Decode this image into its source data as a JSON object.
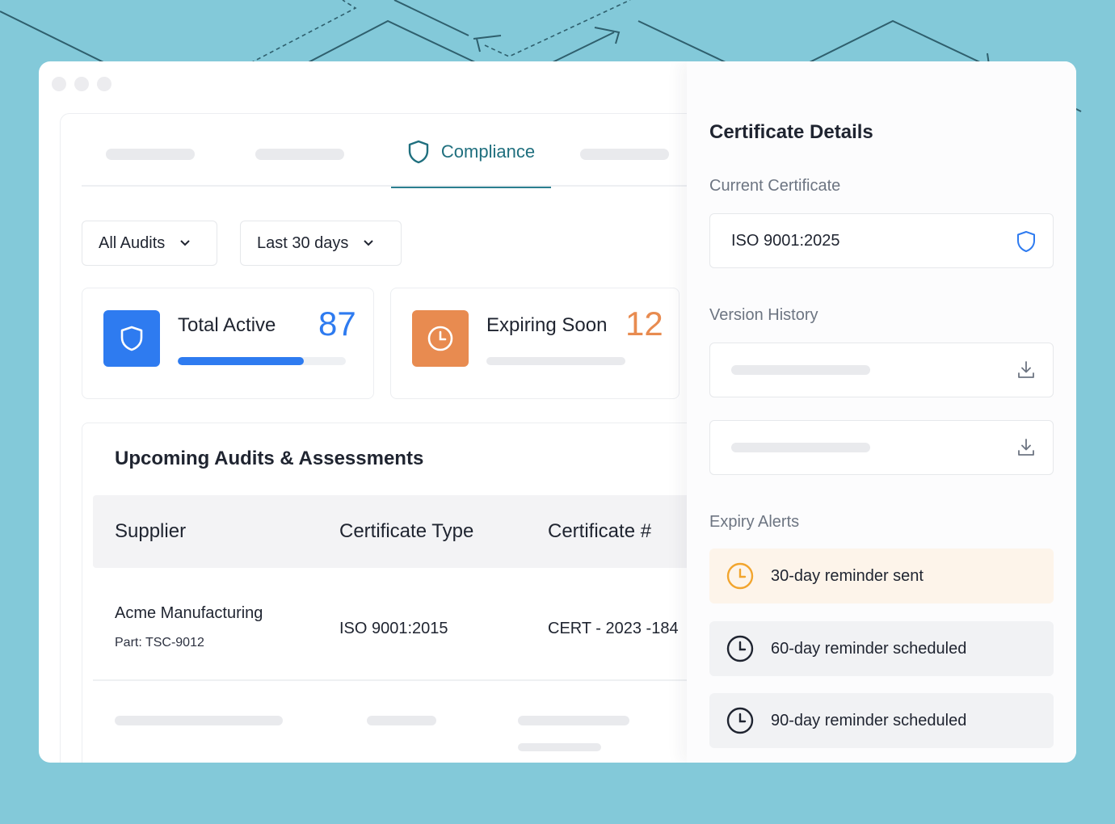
{
  "colors": {
    "background": "#83c9d9",
    "brand_teal": "#1f6f7e",
    "accent_blue": "#2e7bf0",
    "accent_orange": "#e88b50",
    "alert_orange": "#f2a52e"
  },
  "tabs": {
    "active_icon": "shield-icon",
    "active_label": "Compliance"
  },
  "filters": {
    "audit_filter": "All Audits",
    "date_filter": "Last 30 days"
  },
  "stats": {
    "total_active": {
      "label": "Total Active",
      "value": "87",
      "icon": "shield-icon",
      "progress": 0.75
    },
    "expiring_soon": {
      "label": "Expiring Soon",
      "value": "12",
      "icon": "clock-icon"
    }
  },
  "audits": {
    "title": "Upcoming Audits & Assessments",
    "columns": [
      "Supplier",
      "Certificate Type",
      "Certificate #"
    ],
    "rows": [
      {
        "supplier": "Acme Manufacturing",
        "part": "Part: TSC-9012",
        "certificate_type": "ISO 9001:2015",
        "certificate_number": "CERT - 2023 -184"
      }
    ]
  },
  "certificate_details": {
    "title": "Certificate Details",
    "current_label": "Current Certificate",
    "current_value": "ISO 9001:2025",
    "version_history_label": "Version History",
    "expiry_alerts_label": "Expiry Alerts",
    "alerts": [
      {
        "text": "30-day reminder sent",
        "status": "sent"
      },
      {
        "text": "60-day reminder scheduled",
        "status": "scheduled"
      },
      {
        "text": "90-day reminder scheduled",
        "status": "scheduled"
      }
    ]
  }
}
